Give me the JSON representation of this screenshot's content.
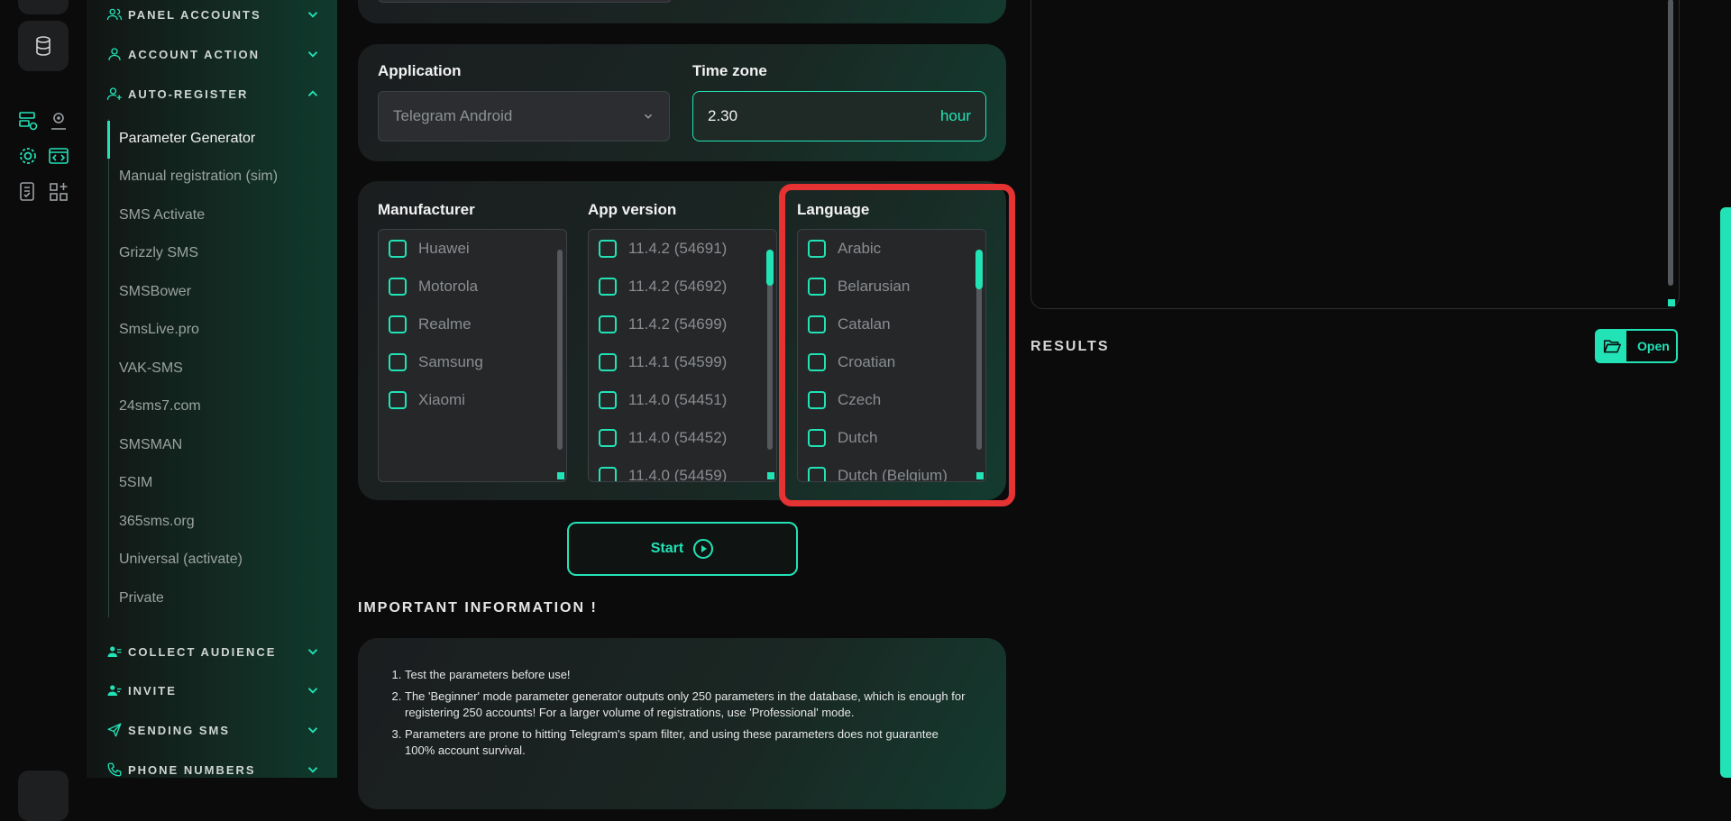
{
  "sidebar": {
    "sections_top": [
      {
        "title": "PANEL ACCOUNTS",
        "icon": "users-icon"
      },
      {
        "title": "ACCOUNT ACTION",
        "icon": "user-icon"
      },
      {
        "title": "AUTO-REGISTER",
        "icon": "user-plus-icon"
      }
    ],
    "items": [
      "Parameter Generator",
      "Manual registration (sim)",
      "SMS Activate",
      "Grizzly SMS",
      "SMSBower",
      "SmsLive.pro",
      "VAK-SMS",
      "24sms7.com",
      "SMSMAN",
      "5SIM",
      "365sms.org",
      "Universal (activate)",
      "Private"
    ],
    "sections_bottom": [
      {
        "title": "COLLECT AUDIENCE",
        "icon": "users-icon"
      },
      {
        "title": "INVITE",
        "icon": "user-add-icon"
      },
      {
        "title": "SENDING SMS",
        "icon": "send-icon"
      },
      {
        "title": "PHONE NUMBERS",
        "icon": "phone-icon"
      }
    ]
  },
  "application": {
    "label": "Application",
    "value": "Telegram Android"
  },
  "timezone": {
    "label": "Time zone",
    "value": "2.30",
    "unit": "hour"
  },
  "manufacturer": {
    "label": "Manufacturer",
    "options": [
      "Huawei",
      "Motorola",
      "Realme",
      "Samsung",
      "Xiaomi"
    ]
  },
  "app_version": {
    "label": "App version",
    "options": [
      "11.4.2 (54691)",
      "11.4.2 (54692)",
      "11.4.2 (54699)",
      "11.4.1 (54599)",
      "11.4.0 (54451)",
      "11.4.0 (54452)",
      "11.4.0 (54459)"
    ]
  },
  "language": {
    "label": "Language",
    "options": [
      "Arabic",
      "Belarusian",
      "Catalan",
      "Croatian",
      "Czech",
      "Dutch",
      "Dutch (Belgium)"
    ]
  },
  "start_label": "Start",
  "info": {
    "title": "IMPORTANT INFORMATION !",
    "items": [
      "Test the parameters before use!",
      "The 'Beginner' mode parameter generator outputs only 250 parameters in the database, which is enough for registering 250 accounts! For a larger volume of registrations, use 'Professional' mode.",
      "Parameters are prone to hitting Telegram's spam filter, and using these parameters does not guarantee 100% account survival."
    ]
  },
  "results": {
    "title": "RESULTS",
    "open_label": "Open"
  },
  "colors": {
    "accent": "#22e3b6",
    "highlight": "#e53232",
    "background": "#0b0b0c"
  }
}
